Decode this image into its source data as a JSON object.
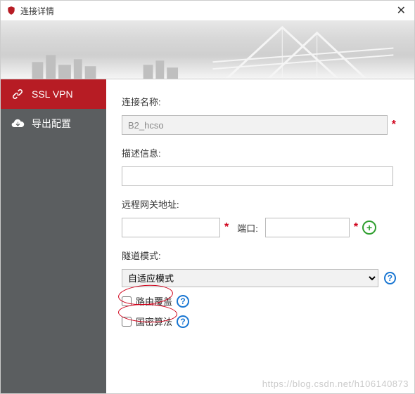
{
  "window": {
    "title": "连接详情"
  },
  "sidebar": {
    "items": [
      {
        "label": "SSL VPN"
      },
      {
        "label": "导出配置"
      }
    ]
  },
  "form": {
    "name_label": "连接名称:",
    "name_value": "B2_hcso",
    "desc_label": "描述信息:",
    "desc_value": "",
    "gateway_label": "远程网关地址:",
    "gateway_value": "",
    "port_label": "端口:",
    "port_value": "",
    "tunnel_label": "隧道模式:",
    "tunnel_selected": "自适应模式",
    "route_override_label": "路由覆盖",
    "gm_algo_label": "国密算法"
  },
  "watermark": "https://blog.csdn.net/h106140873"
}
